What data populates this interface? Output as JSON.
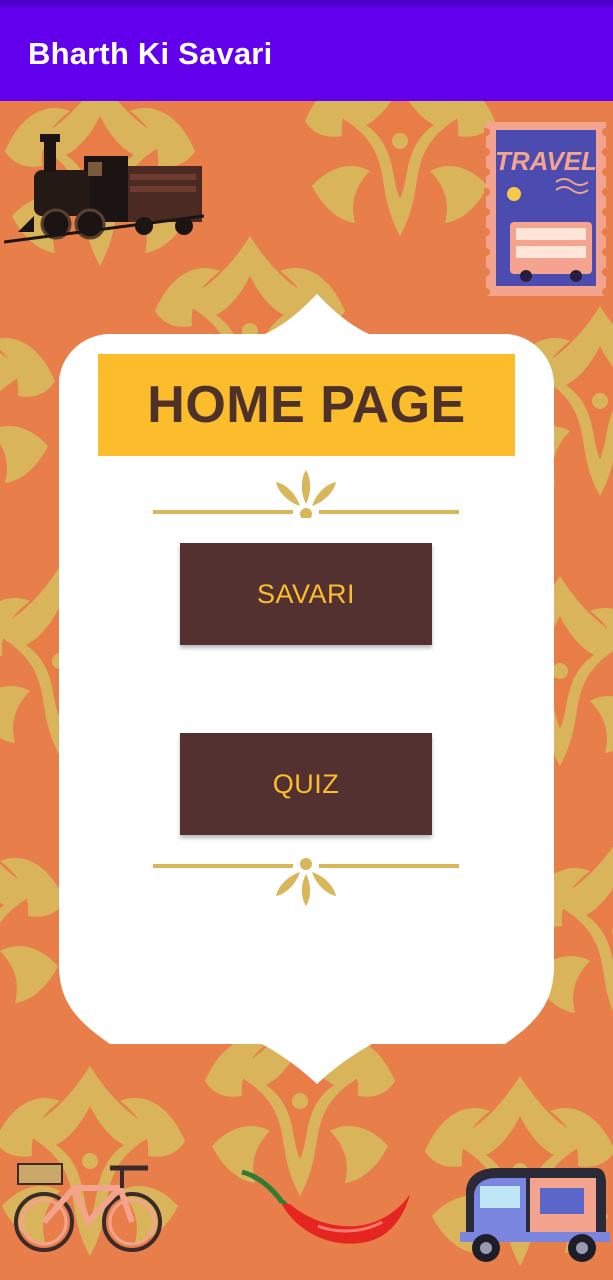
{
  "app_bar": {
    "title": "Bharth Ki Savari",
    "color": "#6200EE"
  },
  "card": {
    "title": "HOME PAGE",
    "buttons": [
      {
        "label": "SAVARI"
      },
      {
        "label": "QUIZ"
      }
    ]
  },
  "stickers": {
    "top_left": "steam-train-icon",
    "top_right": "travel-stamp-icon",
    "travel_stamp_text": "TRAVEL",
    "bottom_left": "bicycle-icon",
    "bottom_center": "red-chili-icon",
    "bottom_right": "auto-rickshaw-icon"
  },
  "colors": {
    "background": "#E87E49",
    "pattern": "#D9B85C",
    "banner": "#FBBD2B",
    "button": "#533131",
    "button_text": "#FBBD2B",
    "ornament": "#D8B65A"
  }
}
